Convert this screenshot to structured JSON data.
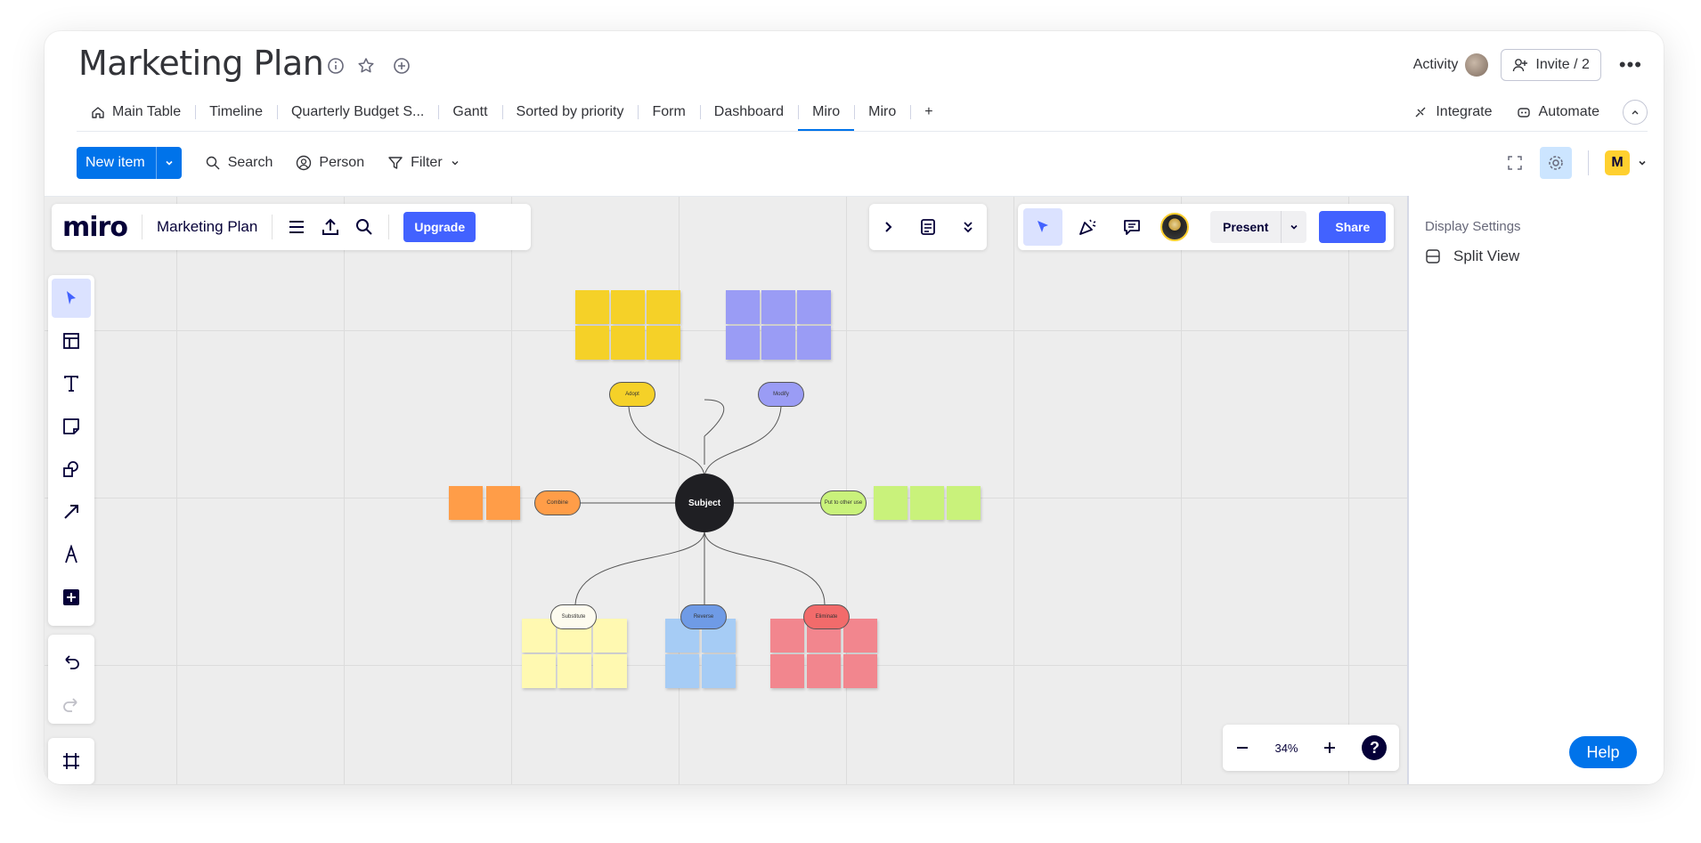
{
  "header": {
    "title": "Marketing Plan",
    "activity_label": "Activity",
    "invite_label": "Invite / 2"
  },
  "tabs": [
    {
      "label": "Main Table"
    },
    {
      "label": "Timeline"
    },
    {
      "label": "Quarterly Budget S..."
    },
    {
      "label": "Gantt"
    },
    {
      "label": "Sorted by priority"
    },
    {
      "label": "Form"
    },
    {
      "label": "Dashboard"
    },
    {
      "label": "Miro"
    },
    {
      "label": "Miro"
    },
    {
      "label": "+"
    }
  ],
  "tab_actions": {
    "integrate": "Integrate",
    "automate": "Automate"
  },
  "toolbar": {
    "new_item": "New item",
    "search": "Search",
    "person": "Person",
    "filter": "Filter"
  },
  "miro": {
    "logo": "miro",
    "board_name": "Marketing Plan",
    "upgrade": "Upgrade",
    "present": "Present",
    "share": "Share",
    "zoom": "34%",
    "help_q": "?"
  },
  "mindmap": {
    "center": "Subject",
    "branches": [
      "Adopt",
      "Modify",
      "Combine",
      "Put to other use",
      "Substitute",
      "Reverse",
      "Eliminate"
    ]
  },
  "side_panel": {
    "title": "Display Settings",
    "item": "Split View",
    "help": "Help"
  },
  "colors": {
    "accent": "#0073ea",
    "miro_blue": "#4262ff",
    "yellow": "#f5d128",
    "purple": "#9a9cf5",
    "orange": "#ff9d48",
    "lime": "#c9f27b",
    "cream": "#fff9b1",
    "blue": "#a6ccf5",
    "red": "#f2868e"
  }
}
